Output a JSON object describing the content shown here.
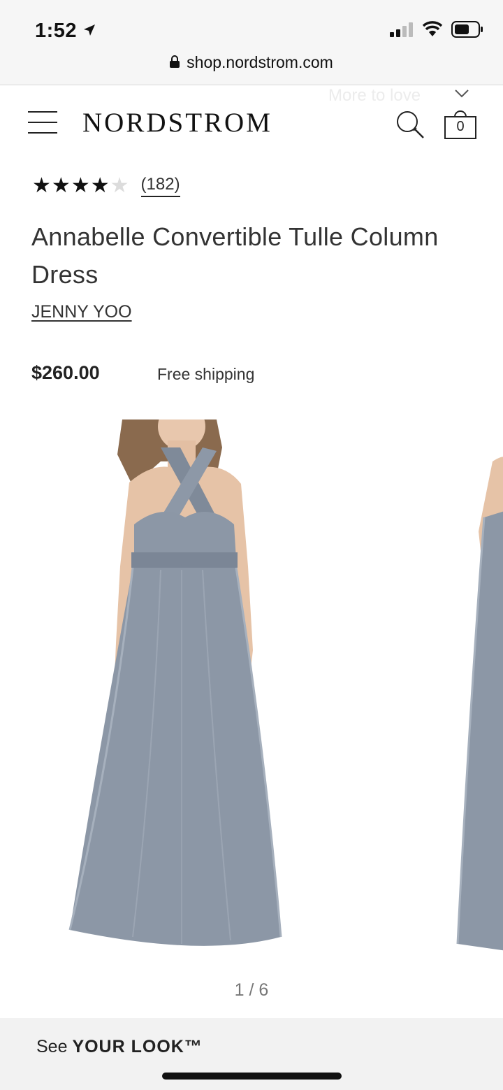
{
  "status_bar": {
    "time": "1:52",
    "url": "shop.nordstrom.com"
  },
  "header": {
    "ghost_text": "More to love",
    "logo": "NORDSTROM",
    "bag_count": "0"
  },
  "product": {
    "rating": 4,
    "rating_max": 5,
    "review_count": "(182)",
    "title": "Annabelle Convertible Tulle Column Dress",
    "brand": "JENNY YOO",
    "price": "$260.00",
    "shipping": "Free shipping"
  },
  "gallery": {
    "counter": "1 / 6",
    "dress_color": "#8c97a6"
  },
  "bottom_bar": {
    "prefix": "See ",
    "label": "YOUR LOOK™"
  },
  "icons": [
    "location-arrow-icon",
    "signal-icon",
    "wifi-icon",
    "battery-icon",
    "lock-icon",
    "chevron-down-icon",
    "menu-icon",
    "search-icon",
    "shopping-bag-icon",
    "star-icon"
  ]
}
